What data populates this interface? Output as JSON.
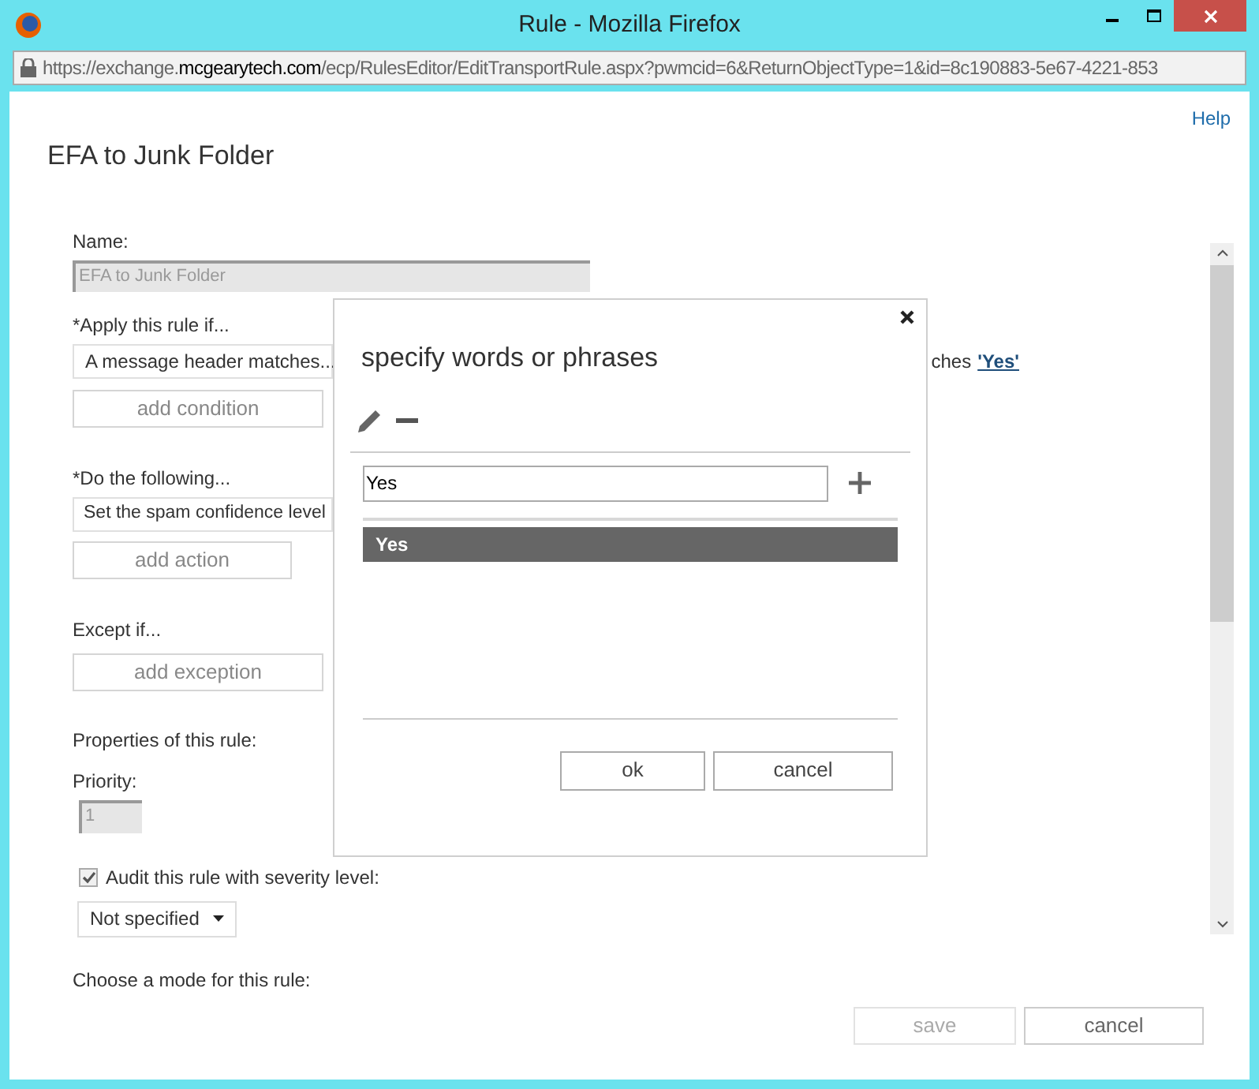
{
  "window": {
    "title": "Rule - Mozilla Firefox"
  },
  "address_bar": {
    "url_prefix": "https://exchange.",
    "url_domain": "mcgearytech.com",
    "url_path": "/ecp/RulesEditor/EditTransportRule.aspx?pwmcid=6&ReturnObjectType=1&id=8c190883-5e67-4221-853"
  },
  "help_link": "Help",
  "page_title": "EFA to Junk Folder",
  "form": {
    "name_label": "Name:",
    "name_value": "EFA to Junk Folder",
    "apply_label": "*Apply this rule if...",
    "condition": "A message header matches...",
    "condition_tail": "ches",
    "condition_link": "'Yes'",
    "add_condition": "add condition",
    "do_label": "*Do the following...",
    "action": "Set the spam confidence level",
    "add_action": "add action",
    "except_label": "Except if...",
    "add_exception": "add exception",
    "properties_label": "Properties of this rule:",
    "priority_label": "Priority:",
    "priority_value": "1",
    "audit": {
      "label": "Audit this rule with severity level:",
      "checked": true
    },
    "severity": "Not specified",
    "mode_label": "Choose a mode for this rule:"
  },
  "footer_buttons": [
    {
      "label": "save",
      "disabled": true
    },
    {
      "label": "cancel",
      "disabled": false
    }
  ],
  "dialog": {
    "title": "specify words or phrases",
    "input_value": "Yes",
    "items": [
      {
        "label": "Yes",
        "selected": true
      }
    ],
    "buttons": [
      {
        "label": "ok"
      },
      {
        "label": "cancel"
      }
    ]
  }
}
